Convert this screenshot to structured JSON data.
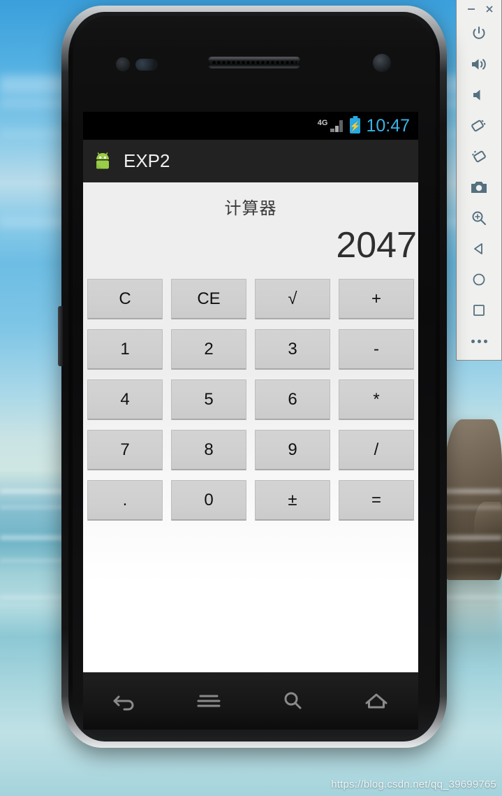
{
  "emulator": {
    "window_controls": [
      {
        "name": "minimize",
        "glyph": "–"
      },
      {
        "name": "close",
        "glyph": "×"
      }
    ],
    "tools": [
      {
        "name": "power-icon",
        "label": "Power"
      },
      {
        "name": "volume-up-icon",
        "label": "Volume Up"
      },
      {
        "name": "volume-down-icon",
        "label": "Volume Down"
      },
      {
        "name": "rotate-left-icon",
        "label": "Rotate Left"
      },
      {
        "name": "rotate-right-icon",
        "label": "Rotate Right"
      },
      {
        "name": "camera-icon",
        "label": "Take Screenshot"
      },
      {
        "name": "zoom-icon",
        "label": "Zoom Mode"
      },
      {
        "name": "back-icon",
        "label": "Back"
      },
      {
        "name": "home-icon",
        "label": "Home"
      },
      {
        "name": "overview-icon",
        "label": "Overview"
      },
      {
        "name": "more-icon",
        "label": "More"
      }
    ]
  },
  "status_bar": {
    "network_label": "4G",
    "battery_state": "charging",
    "clock": "10:47",
    "clock_color": "#3ab3e8"
  },
  "action_bar": {
    "app_icon": "android-robot-icon",
    "app_title": "EXP2",
    "background": "#222222"
  },
  "calculator": {
    "heading": "计算器",
    "display_value": "2047",
    "keys": [
      "C",
      "CE",
      "√",
      "+",
      "1",
      "2",
      "3",
      "-",
      "4",
      "5",
      "6",
      "*",
      "7",
      "8",
      "9",
      "/",
      ".",
      "0",
      "±",
      "="
    ],
    "key_names": [
      "key-clear",
      "key-clear-entry",
      "key-sqrt",
      "key-plus",
      "key-1",
      "key-2",
      "key-3",
      "key-minus",
      "key-4",
      "key-5",
      "key-6",
      "key-multiply",
      "key-7",
      "key-8",
      "key-9",
      "key-divide",
      "key-decimal",
      "key-0",
      "key-plus-minus",
      "key-equals"
    ],
    "key_background": "#d0d0d0"
  },
  "nav_bar": {
    "buttons": [
      {
        "name": "nav-back-icon",
        "label": "Back"
      },
      {
        "name": "nav-menu-icon",
        "label": "Menu"
      },
      {
        "name": "nav-search-icon",
        "label": "Search"
      },
      {
        "name": "nav-home-icon",
        "label": "Home"
      }
    ]
  },
  "watermark": {
    "text": "https://blog.csdn.net/qq_39699765"
  }
}
